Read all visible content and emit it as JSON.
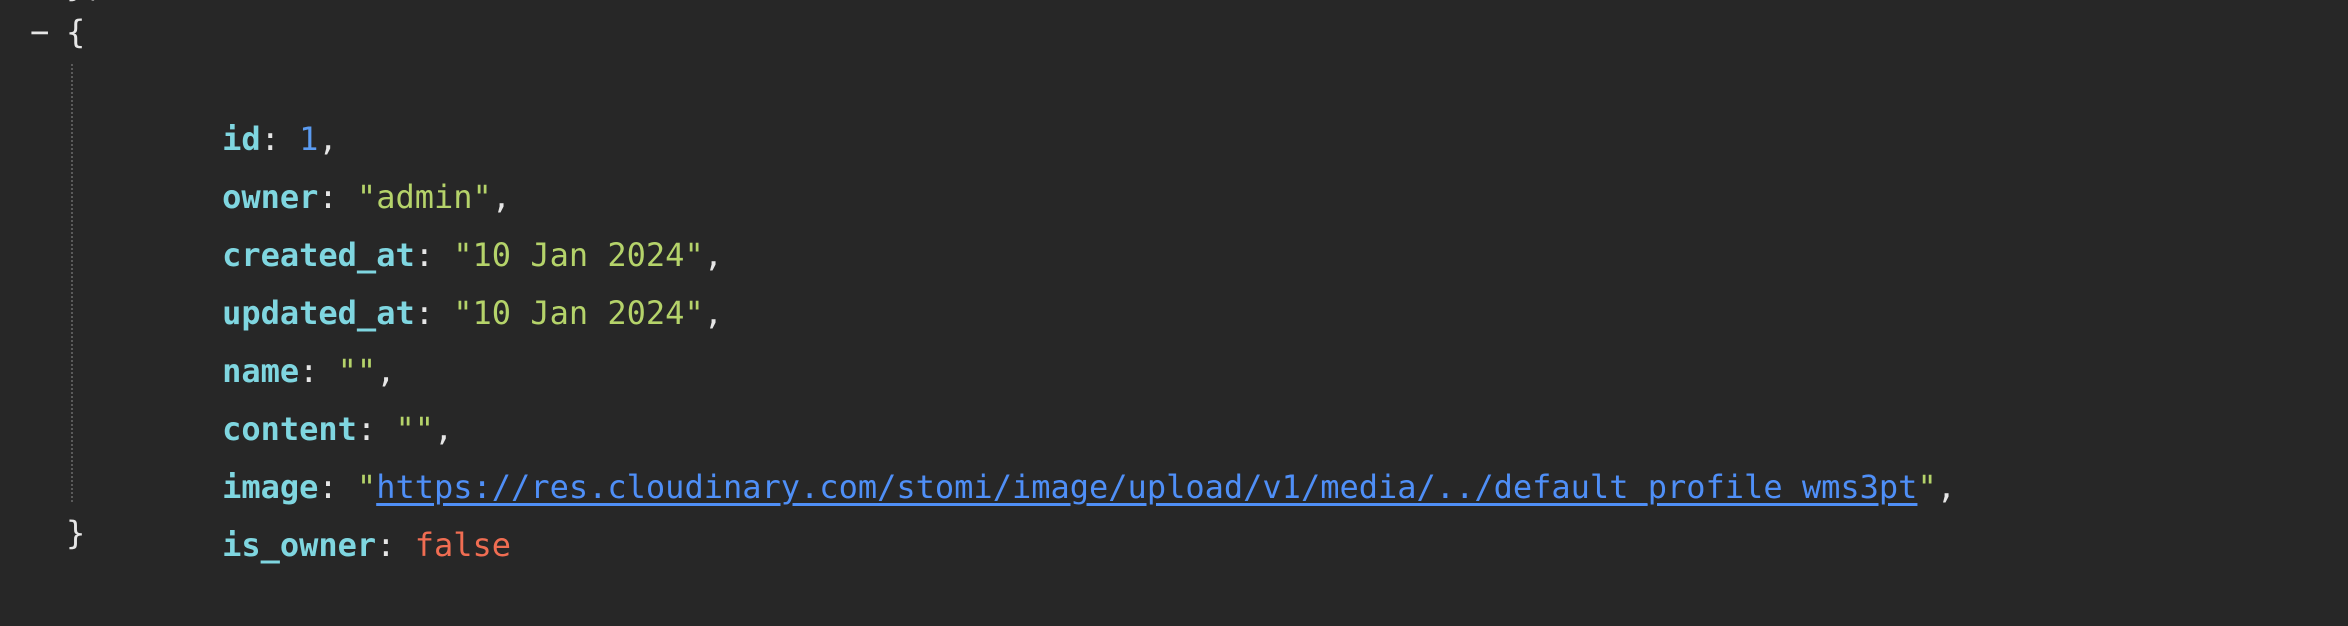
{
  "collapse_toggle": "−",
  "fragment_above": "},",
  "braces": {
    "open": "{",
    "close": "}"
  },
  "properties": [
    {
      "key": "id",
      "value": "1",
      "type": "number",
      "comma": true
    },
    {
      "key": "owner",
      "value": "\"admin\"",
      "type": "string",
      "comma": true
    },
    {
      "key": "created_at",
      "value": "\"10 Jan 2024\"",
      "type": "string",
      "comma": true
    },
    {
      "key": "updated_at",
      "value": "\"10 Jan 2024\"",
      "type": "string",
      "comma": true
    },
    {
      "key": "name",
      "value": "\"\"",
      "type": "string",
      "comma": true
    },
    {
      "key": "content",
      "value": "\"\"",
      "type": "string",
      "comma": true
    },
    {
      "key": "image",
      "quote": "\"",
      "value": "https://res.cloudinary.com/stomi/image/upload/v1/media/../default_profile_wms3pt",
      "type": "link",
      "comma": true
    },
    {
      "key": "is_owner",
      "value": "false",
      "type": "boolean",
      "comma": false
    }
  ],
  "colors": {
    "background": "#272727",
    "key": "#7fd6e0",
    "string": "#b5d36a",
    "number": "#5b9bf0",
    "boolean": "#f06d52",
    "link": "#4f8ff7",
    "punctuation": "#e6e6e6"
  }
}
